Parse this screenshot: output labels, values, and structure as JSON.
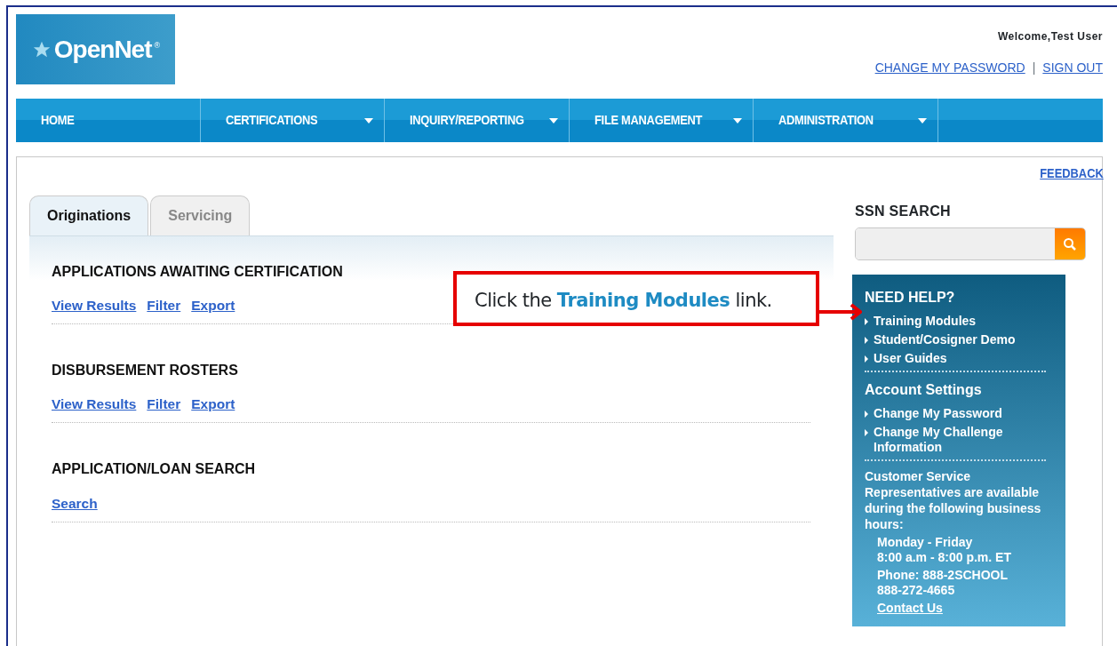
{
  "header": {
    "logo": "OpenNet",
    "logo_mark": "®",
    "welcome": "Welcome,Test User",
    "links": [
      "CHANGE MY PASSWORD",
      "SIGN OUT"
    ],
    "separator": "|"
  },
  "nav": [
    {
      "label": "HOME",
      "dropdown": false
    },
    {
      "label": "CERTIFICATIONS",
      "dropdown": true
    },
    {
      "label": "INQUIRY/REPORTING",
      "dropdown": true
    },
    {
      "label": "FILE MANAGEMENT",
      "dropdown": true
    },
    {
      "label": "ADMINISTRATION",
      "dropdown": true
    }
  ],
  "feedback": "FEEDBACK",
  "tabs": [
    {
      "label": "Originations",
      "selected": true
    },
    {
      "label": "Servicing",
      "selected": false
    }
  ],
  "sections": [
    {
      "title": "APPLICATIONS AWAITING CERTIFICATION",
      "links": [
        "View Results",
        "Filter",
        "Export"
      ]
    },
    {
      "title": "DISBURSEMENT ROSTERS",
      "links": [
        "View Results",
        "Filter",
        "Export"
      ]
    },
    {
      "title": "APPLICATION/LOAN SEARCH",
      "links": [
        "Search"
      ]
    }
  ],
  "ssn_search": {
    "title": "SSN SEARCH"
  },
  "help": {
    "title": "NEED HELP?",
    "links": [
      "Training Modules",
      "Student/Cosigner Demo",
      "User Guides"
    ],
    "account_title": "Account Settings",
    "account_links": [
      "Change My Password",
      "Change My Challenge Information"
    ],
    "service_text": "Customer Service Representatives are available during the following business hours:",
    "hours": [
      "Monday - Friday",
      "8:00 a.m - 8:00 p.m. ET"
    ],
    "phone": [
      "Phone: 888-2SCHOOL",
      "888-272-4665"
    ],
    "contact": "Contact Us"
  },
  "callout": {
    "text": "Click the **Training Modules** link."
  }
}
